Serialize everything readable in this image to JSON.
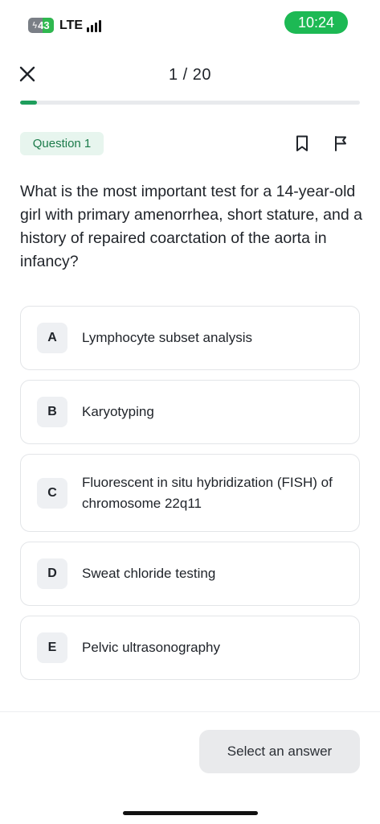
{
  "status_bar": {
    "battery_level": "43",
    "network": "LTE",
    "time": "10:24"
  },
  "header": {
    "progress_label": "1 / 20",
    "progress_fraction": 0.05
  },
  "question": {
    "badge": "Question 1",
    "text": "What is the most important test for a 14-year-old girl with primary amenorrhea, short stature, and a history of repaired coarctation of the aorta in infancy?"
  },
  "options": [
    {
      "letter": "A",
      "text": "Lymphocyte subset analysis"
    },
    {
      "letter": "B",
      "text": "Karyotyping"
    },
    {
      "letter": "C",
      "text": "Fluorescent in situ hybridization (FISH) of chromosome 22q11"
    },
    {
      "letter": "D",
      "text": "Sweat chloride testing"
    },
    {
      "letter": "E",
      "text": "Pelvic ultrasonography"
    }
  ],
  "footer": {
    "submit_label": "Select an answer"
  },
  "icons": {
    "close": "close-icon",
    "bookmark": "bookmark-icon",
    "flag": "flag-icon"
  },
  "colors": {
    "accent": "#1e9e5c",
    "badge_bg": "#e7f5ee",
    "time_pill": "#1db954"
  }
}
